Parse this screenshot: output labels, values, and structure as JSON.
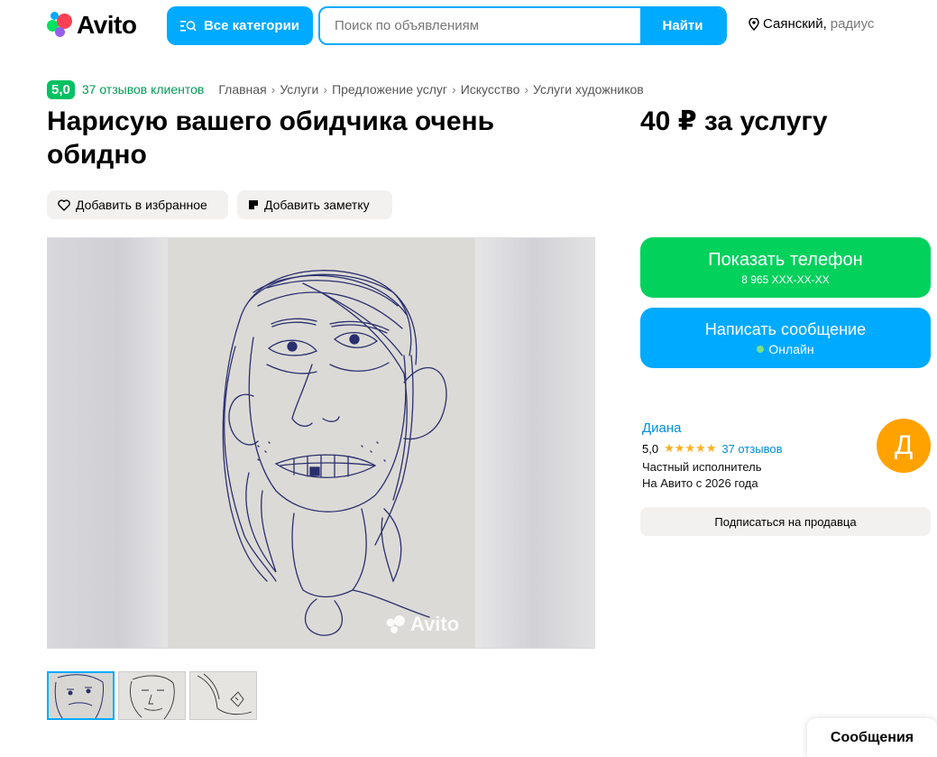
{
  "header": {
    "logo_text": "Avito",
    "categories_label": "Все категории",
    "search_placeholder": "Поиск по объявлениям",
    "search_button": "Найти",
    "location_city": "Саянский,",
    "location_radius": "радиус"
  },
  "breadcrumbs": {
    "rating": "5,0",
    "reviews": "37 отзывов клиентов",
    "items": [
      "Главная",
      "Услуги",
      "Предложение услуг",
      "Искусство",
      "Услуги художников"
    ]
  },
  "listing": {
    "title": "Нарисую вашего обидчика очень обидно",
    "price": "40 ₽ за услугу",
    "favorite_label": "Добавить в избранное",
    "note_label": "Добавить заметку",
    "watermark": "Avito"
  },
  "contact": {
    "phone_label": "Показать телефон",
    "phone_masked": "8 965 XXX-XX-XX",
    "message_label": "Написать сообщение",
    "status": "Онлайн"
  },
  "seller": {
    "name": "Диана",
    "rating": "5,0",
    "stars": "★★★★★",
    "reviews": "37 отзывов",
    "type": "Частный исполнитель",
    "since": "На Авито с 2026 года",
    "avatar_letter": "Д",
    "subscribe_label": "Подписаться на продавца"
  },
  "footer": {
    "messages_label": "Сообщения"
  },
  "colors": {
    "brand_blue": "#00aaff",
    "brand_green": "#02d15c",
    "avatar_orange": "#ffa200"
  }
}
